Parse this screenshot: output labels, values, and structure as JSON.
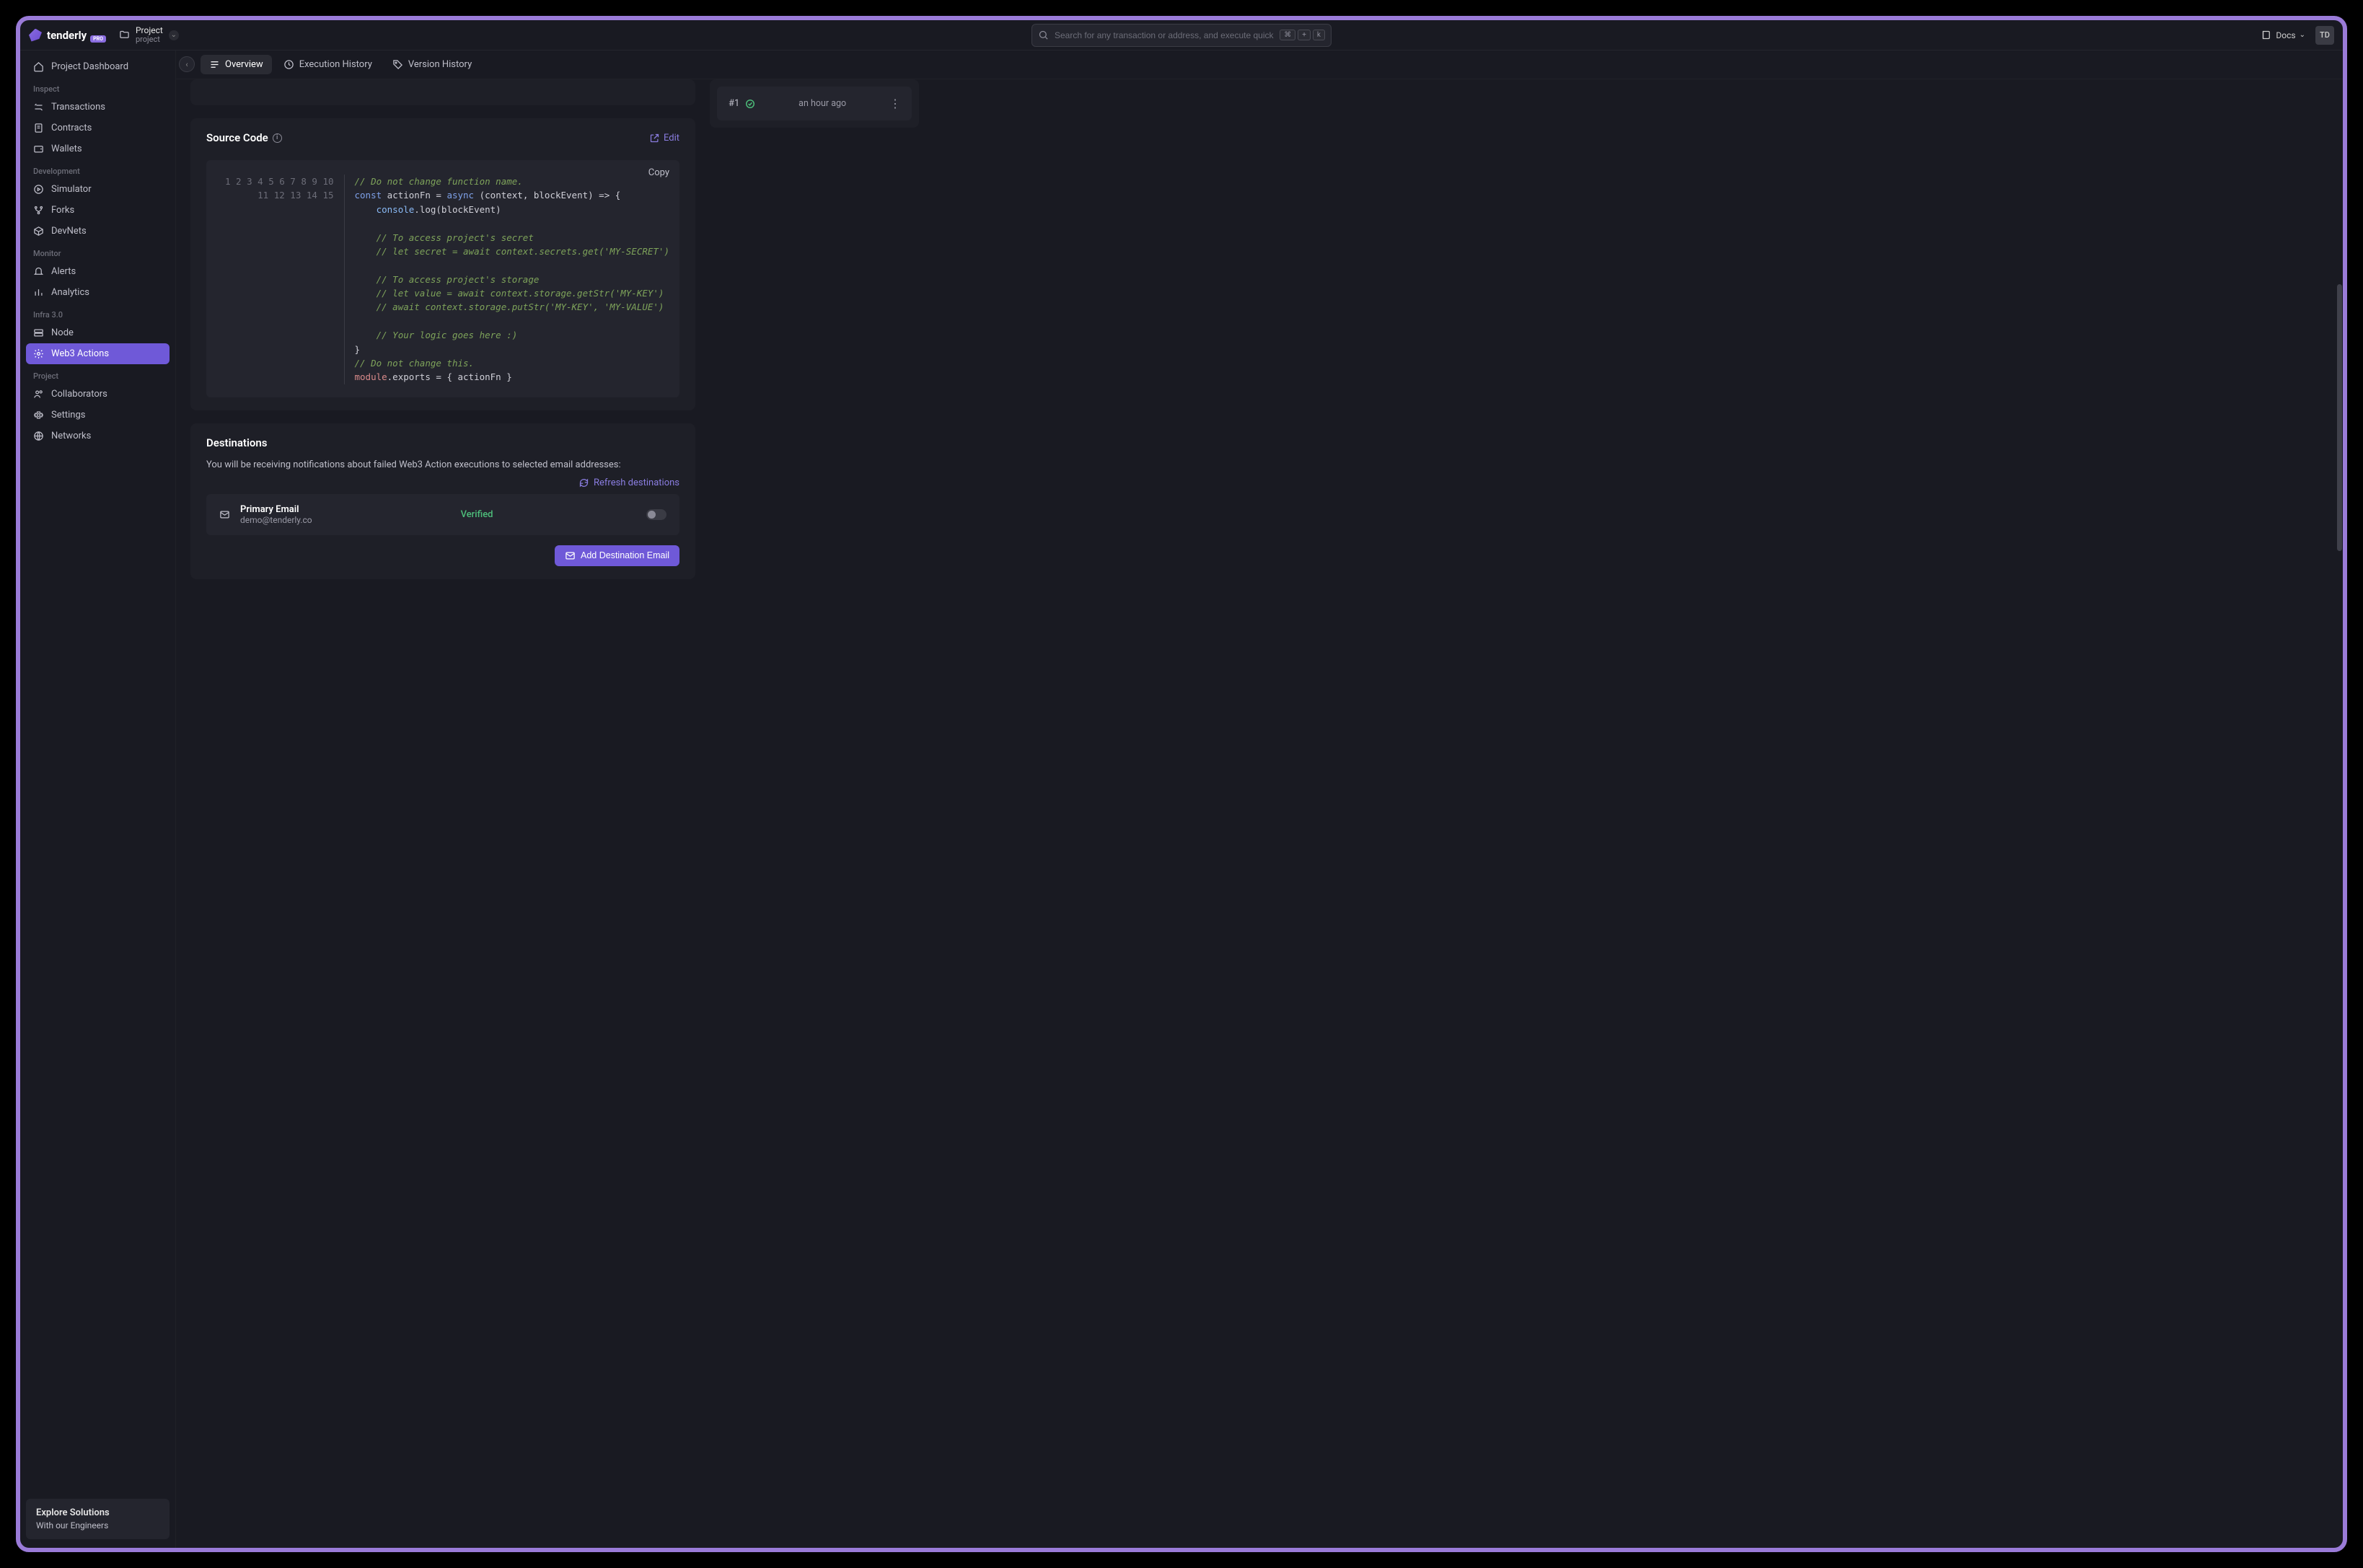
{
  "brand": {
    "name": "tenderly",
    "badge": "PRO"
  },
  "project": {
    "label": "Project",
    "name": "project"
  },
  "search": {
    "placeholder": "Search for any transaction or address, and execute quick c...",
    "kbd": [
      "⌘",
      "+",
      "k"
    ]
  },
  "top": {
    "docs": "Docs",
    "avatar": "TD"
  },
  "sidebar": {
    "dashboard": "Project Dashboard",
    "groups": [
      {
        "title": "Inspect",
        "items": [
          "Transactions",
          "Contracts",
          "Wallets"
        ]
      },
      {
        "title": "Development",
        "items": [
          "Simulator",
          "Forks",
          "DevNets"
        ]
      },
      {
        "title": "Monitor",
        "items": [
          "Alerts",
          "Analytics"
        ]
      },
      {
        "title": "Infra 3.0",
        "items": [
          "Node",
          "Web3 Actions"
        ]
      },
      {
        "title": "Project",
        "items": [
          "Collaborators",
          "Settings",
          "Networks"
        ]
      }
    ],
    "explore": {
      "title": "Explore Solutions",
      "sub": "With our Engineers"
    }
  },
  "tabs": [
    "Overview",
    "Execution History",
    "Version History"
  ],
  "source": {
    "title": "Source Code",
    "edit": "Edit",
    "copy": "Copy",
    "code_lines": [
      {
        "n": 1,
        "t": "comment",
        "text": "// Do not change function name."
      },
      {
        "n": 2,
        "t": "code",
        "html": "<span class=\"c-kw\">const</span> actionFn = <span class=\"c-kw2\">async</span> (context, blockEvent) =&gt; {"
      },
      {
        "n": 3,
        "t": "code",
        "html": "    <span class=\"c-fn\">console</span>.log(blockEvent)"
      },
      {
        "n": 4,
        "t": "blank",
        "text": ""
      },
      {
        "n": 5,
        "t": "comment",
        "text": "    // To access project's secret"
      },
      {
        "n": 6,
        "t": "comment",
        "text": "    // let secret = await context.secrets.get('MY-SECRET')"
      },
      {
        "n": 7,
        "t": "blank",
        "text": ""
      },
      {
        "n": 8,
        "t": "comment",
        "text": "    // To access project's storage"
      },
      {
        "n": 9,
        "t": "comment",
        "text": "    // let value = await context.storage.getStr('MY-KEY')"
      },
      {
        "n": 10,
        "t": "comment",
        "text": "    // await context.storage.putStr('MY-KEY', 'MY-VALUE')"
      },
      {
        "n": 11,
        "t": "blank",
        "text": ""
      },
      {
        "n": 12,
        "t": "comment",
        "text": "    // Your logic goes here :)"
      },
      {
        "n": 13,
        "t": "code",
        "html": "}"
      },
      {
        "n": 14,
        "t": "comment",
        "text": "// Do not change this."
      },
      {
        "n": 15,
        "t": "code",
        "html": "<span class=\"c-mod\">module</span>.exports = { actionFn }"
      }
    ]
  },
  "dest": {
    "title": "Destinations",
    "sub": "You will be receiving notifications about failed Web3 Action executions to selected email addresses:",
    "refresh": "Refresh destinations",
    "item": {
      "name": "Primary Email",
      "email": "demo@tenderly.co",
      "status": "Verified"
    },
    "add_btn": "Add Destination Email"
  },
  "version": {
    "index": "#1",
    "time": "an hour ago"
  }
}
